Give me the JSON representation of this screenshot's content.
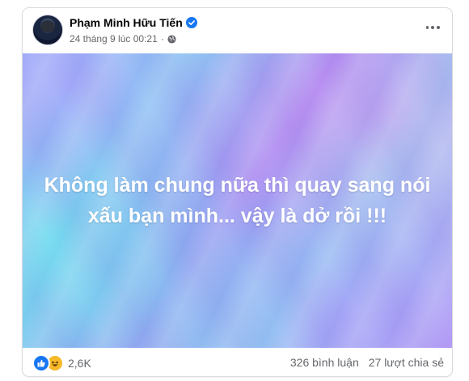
{
  "post": {
    "author_name": "Phạm Minh Hữu Tiến",
    "timestamp": "24 tháng 9 lúc 00:21",
    "separator": "·",
    "text": "Không làm chung nữa thì quay sang nói xấu bạn mình... vậy là dở rồi !!!"
  },
  "icons": {
    "verified": "verified-badge-icon",
    "privacy": "globe-icon",
    "more": "more-options-icon",
    "reaction_1": "like-icon",
    "reaction_2": "haha-icon"
  },
  "colors": {
    "brand_blue": "#1877f2",
    "haha_yellow": "#f7b928",
    "secondary_text": "#65676b"
  },
  "engagement": {
    "reaction_count": "2,6K",
    "comments": "326 bình luận",
    "shares": "27 lượt chia sẻ"
  }
}
